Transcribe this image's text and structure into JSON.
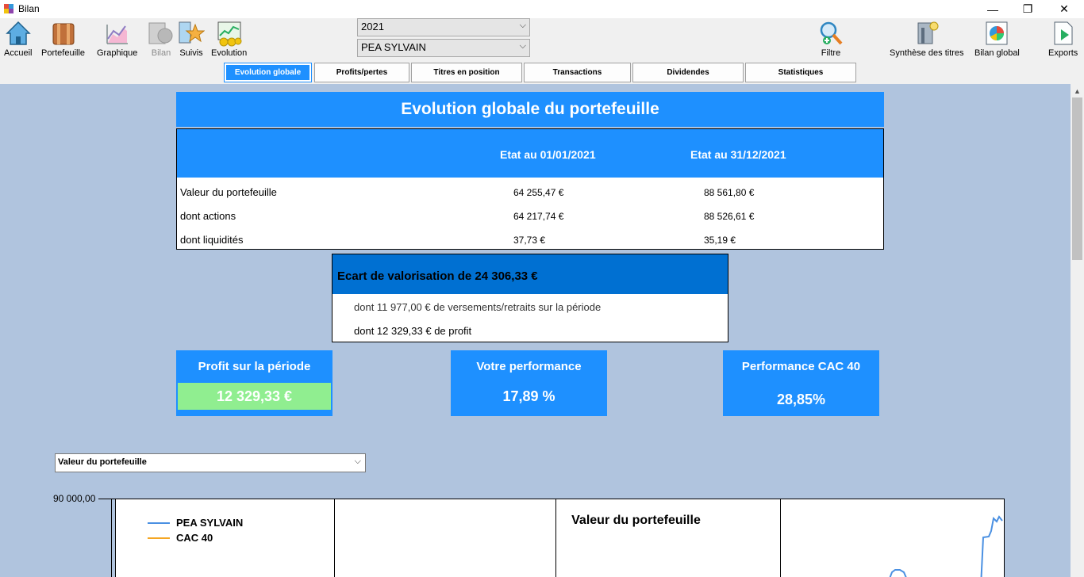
{
  "window": {
    "title": "Bilan",
    "minimize": "—",
    "restore": "❐",
    "close": "✕"
  },
  "toolbar": {
    "items": [
      {
        "label": "Accueil",
        "icon": "home-icon",
        "enabled": true
      },
      {
        "label": "Portefeuille",
        "icon": "portfolio-icon",
        "enabled": true
      },
      {
        "label": "Graphique",
        "icon": "chart-icon",
        "enabled": true
      },
      {
        "label": "Bilan",
        "icon": "bilan-icon",
        "enabled": false
      },
      {
        "label": "Suivis",
        "icon": "star-icon",
        "enabled": true
      },
      {
        "label": "Evolution",
        "icon": "evolution-icon",
        "enabled": true
      },
      {
        "label": "Filtre",
        "icon": "filter-magnifier-icon",
        "enabled": true
      },
      {
        "label": "Synthèse des titres",
        "icon": "synthesis-icon",
        "enabled": true
      },
      {
        "label": "Bilan global",
        "icon": "global-report-icon",
        "enabled": true
      },
      {
        "label": "Exports",
        "icon": "export-icon",
        "enabled": true
      }
    ],
    "year_select": "2021",
    "account_select": "PEA SYLVAIN"
  },
  "tabs": [
    {
      "label": "Evolution globale",
      "active": true
    },
    {
      "label": "Profits/pertes",
      "active": false
    },
    {
      "label": "Titres en position",
      "active": false
    },
    {
      "label": "Transactions",
      "active": false
    },
    {
      "label": "Dividendes",
      "active": false
    },
    {
      "label": "Statistiques",
      "active": false
    }
  ],
  "main": {
    "title": "Evolution globale du portefeuille",
    "table": {
      "col1": "Etat au 01/01/2021",
      "col2": "Etat au 31/12/2021",
      "rows": [
        {
          "label": "Valeur du portefeuille",
          "v1": "64 255,47 €",
          "v2": "88 561,80 €"
        },
        {
          "label": "dont actions",
          "v1": "64 217,74 €",
          "v2": "88 526,61 €"
        },
        {
          "label": "dont liquidités",
          "v1": "37,73 €",
          "v2": "35,19 €"
        }
      ]
    },
    "ecart": {
      "title": "Ecart de valorisation de 24 306,33 €",
      "line1": "dont 11 977,00 € de versements/retraits sur la période",
      "line2": "dont 12 329,33 € de profit"
    },
    "kpis": {
      "profit": {
        "title": "Profit sur la période",
        "value": "12 329,33 €"
      },
      "perf": {
        "title": "Votre performance",
        "value": "17,89 %"
      },
      "cac": {
        "title": "Performance CAC 40",
        "value": "28,85%"
      }
    },
    "chart_select": "Valeur du portefeuille",
    "chart": {
      "y_top_label": "90 000,00",
      "title": "Valeur du portefeuille",
      "legend": [
        {
          "name": "PEA SYLVAIN",
          "color": "#4a90e2"
        },
        {
          "name": "CAC 40",
          "color": "#f5a623"
        }
      ]
    }
  },
  "colors": {
    "accent": "#1e90ff",
    "dark_accent": "#0070d2",
    "profit_green": "#90ee90",
    "background": "#b0c4de"
  }
}
